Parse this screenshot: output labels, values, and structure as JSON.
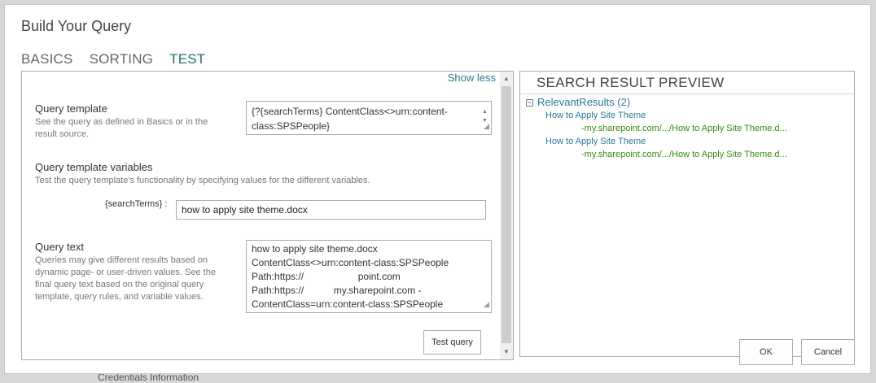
{
  "background": {
    "behind_text": "Credentials Information"
  },
  "dialog": {
    "title": "Build Your Query",
    "tabs": [
      {
        "label": "BASICS",
        "active": false
      },
      {
        "label": "SORTING",
        "active": false
      },
      {
        "label": "TEST",
        "active": true
      }
    ]
  },
  "left": {
    "show_less": "Show less",
    "query_template": {
      "label": "Query template",
      "description": "See the query as defined in Basics or in the result source.",
      "value_line1": "{?{searchTerms} ContentClass<>urn:content-",
      "value_line2": "class:SPSPeople}"
    },
    "template_variables": {
      "label": "Query template variables",
      "description": "Test the query template's functionality by specifying values for the different variables.",
      "var_name": "{searchTerms} :",
      "var_value": "how to apply site theme.docx"
    },
    "query_text": {
      "label": "Query text",
      "description": "Queries may give different results based on dynamic page- or user-driven values. See the final query text based on the original query template, query rules, and variable values.",
      "lines": [
        "how to apply site theme.docx",
        "ContentClass<>urn:content-class:SPSPeople",
        "Path:https://                    point.com",
        "Path:https://           my.sharepoint.com -",
        "ContentClass=urn:content-class:SPSPeople"
      ]
    },
    "test_button": "Test query"
  },
  "right": {
    "title": "SEARCH RESULT PREVIEW",
    "group": "RelevantResults (2)",
    "toggle_symbol": "−",
    "results": [
      {
        "title": "How to Apply Site Theme",
        "url": "-my.sharepoint.com/.../How to Apply Site Theme.d..."
      },
      {
        "title": "How to Apply Site Theme",
        "url": "-my.sharepoint.com/.../How to Apply Site Theme.d..."
      }
    ]
  },
  "footer": {
    "ok": "OK",
    "cancel": "Cancel"
  },
  "icons": {
    "scroll_up": "▲",
    "scroll_down": "▼",
    "resize_grip": "◢"
  },
  "colors": {
    "accent": "#1f6f6a",
    "link": "#2a7a9a",
    "url_green": "#3a8a10",
    "border": "#ababab"
  }
}
